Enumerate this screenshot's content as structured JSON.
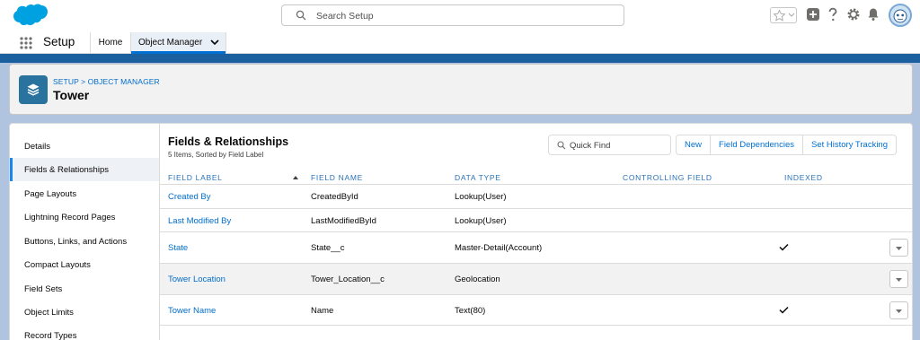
{
  "header": {
    "search_placeholder": "Search Setup",
    "brand_color": "#00a1e0"
  },
  "nav": {
    "app_name": "Setup",
    "home_label": "Home",
    "object_manager_label": "Object Manager"
  },
  "page_header": {
    "breadcrumb": "SETUP > OBJECT MANAGER",
    "title": "Tower"
  },
  "sidebar": {
    "items": [
      {
        "label": "Details"
      },
      {
        "label": "Fields & Relationships",
        "active": true
      },
      {
        "label": "Page Layouts"
      },
      {
        "label": "Lightning Record Pages"
      },
      {
        "label": "Buttons, Links, and Actions"
      },
      {
        "label": "Compact Layouts"
      },
      {
        "label": "Field Sets"
      },
      {
        "label": "Object Limits"
      },
      {
        "label": "Record Types"
      }
    ]
  },
  "content": {
    "title": "Fields & Relationships",
    "subtitle": "5 Items, Sorted by Field Label",
    "quick_find_placeholder": "Quick Find",
    "buttons": {
      "new": "New",
      "field_dependencies": "Field Dependencies",
      "history_tracking": "Set History Tracking"
    },
    "columns": {
      "field_label": "FIELD LABEL",
      "field_name": "FIELD NAME",
      "data_type": "DATA TYPE",
      "controlling_field": "CONTROLLING FIELD",
      "indexed": "INDEXED"
    },
    "rows": [
      {
        "label": "Created By",
        "name": "CreatedById",
        "type": "Lookup(User)",
        "controlling": "",
        "indexed": false
      },
      {
        "label": "Last Modified By",
        "name": "LastModifiedById",
        "type": "Lookup(User)",
        "controlling": "",
        "indexed": false
      },
      {
        "label": "State",
        "name": "State__c",
        "type": "Master-Detail(Account)",
        "controlling": "",
        "indexed": true
      },
      {
        "label": "Tower Location",
        "name": "Tower_Location__c",
        "type": "Geolocation",
        "controlling": "",
        "indexed": false
      },
      {
        "label": "Tower Name",
        "name": "Name",
        "type": "Text(80)",
        "controlling": "",
        "indexed": true
      }
    ]
  }
}
